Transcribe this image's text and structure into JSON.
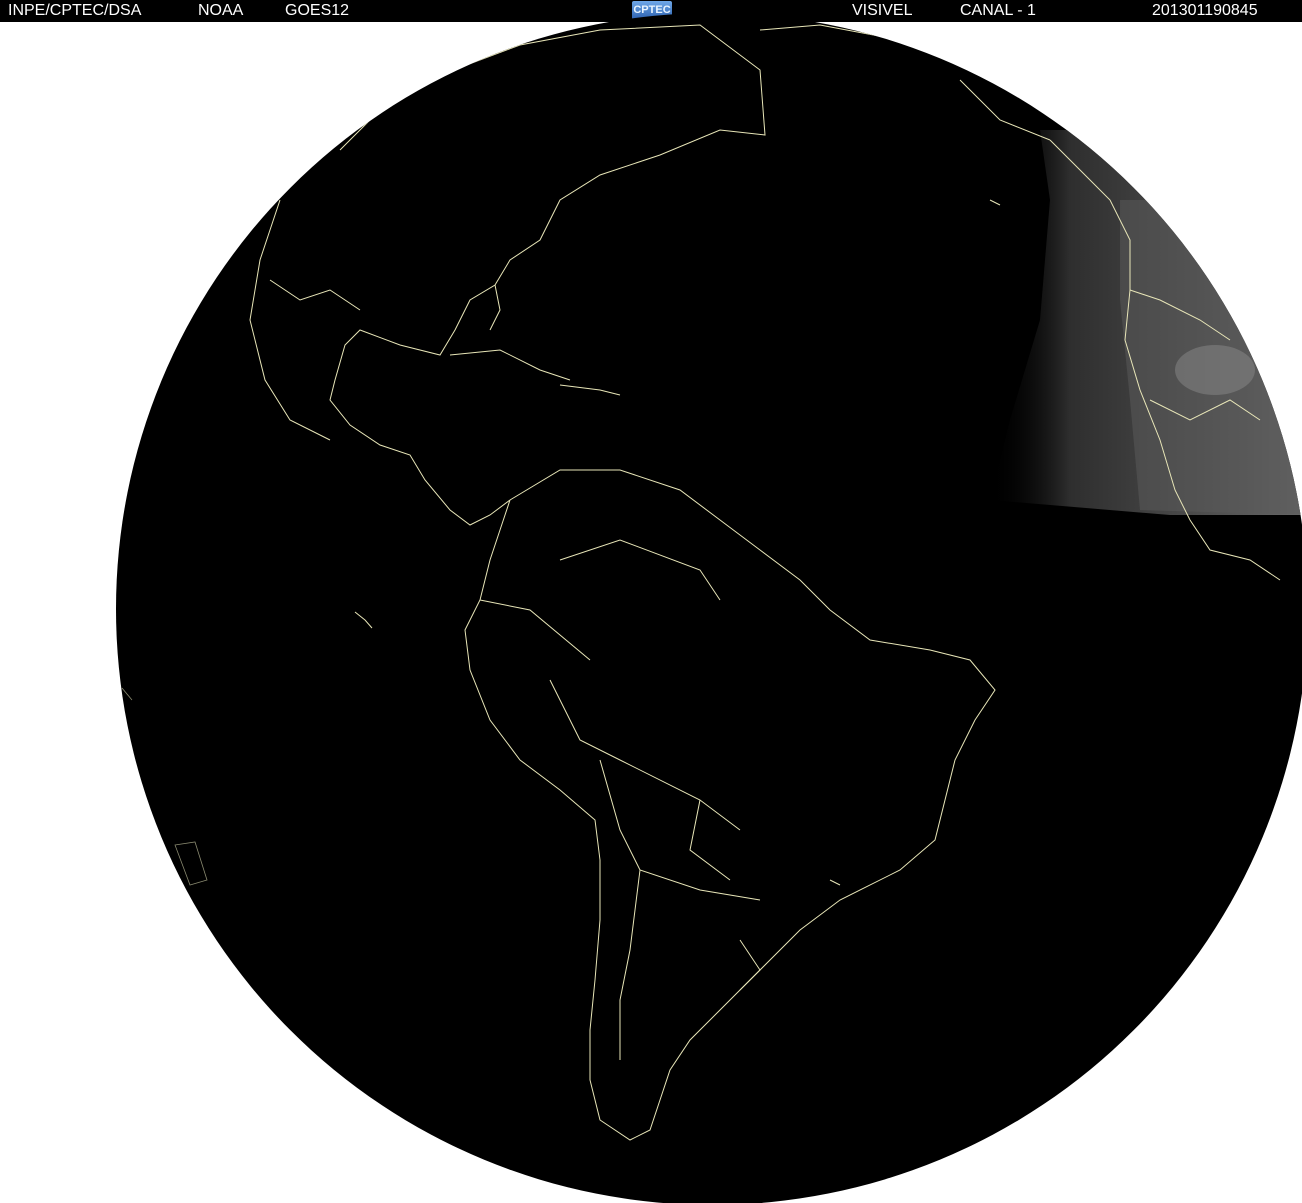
{
  "header": {
    "agency": "INPE/CPTEC/DSA",
    "operator": "NOAA",
    "satellite": "GOES12",
    "logo_text": "CPTEC",
    "band": "VISIVEL",
    "channel": "CANAL - 1",
    "timestamp": "201301190845"
  },
  "image": {
    "type": "full-disk satellite image",
    "illumination": "night side dark, daylight on eastern limb (Africa)",
    "colors": {
      "background": "#ffffff",
      "disk": "#000000",
      "coastlines": "#e8e6b8",
      "daylight_region": "#555555",
      "header_bar": "#000000",
      "header_text": "#ffffff"
    }
  }
}
